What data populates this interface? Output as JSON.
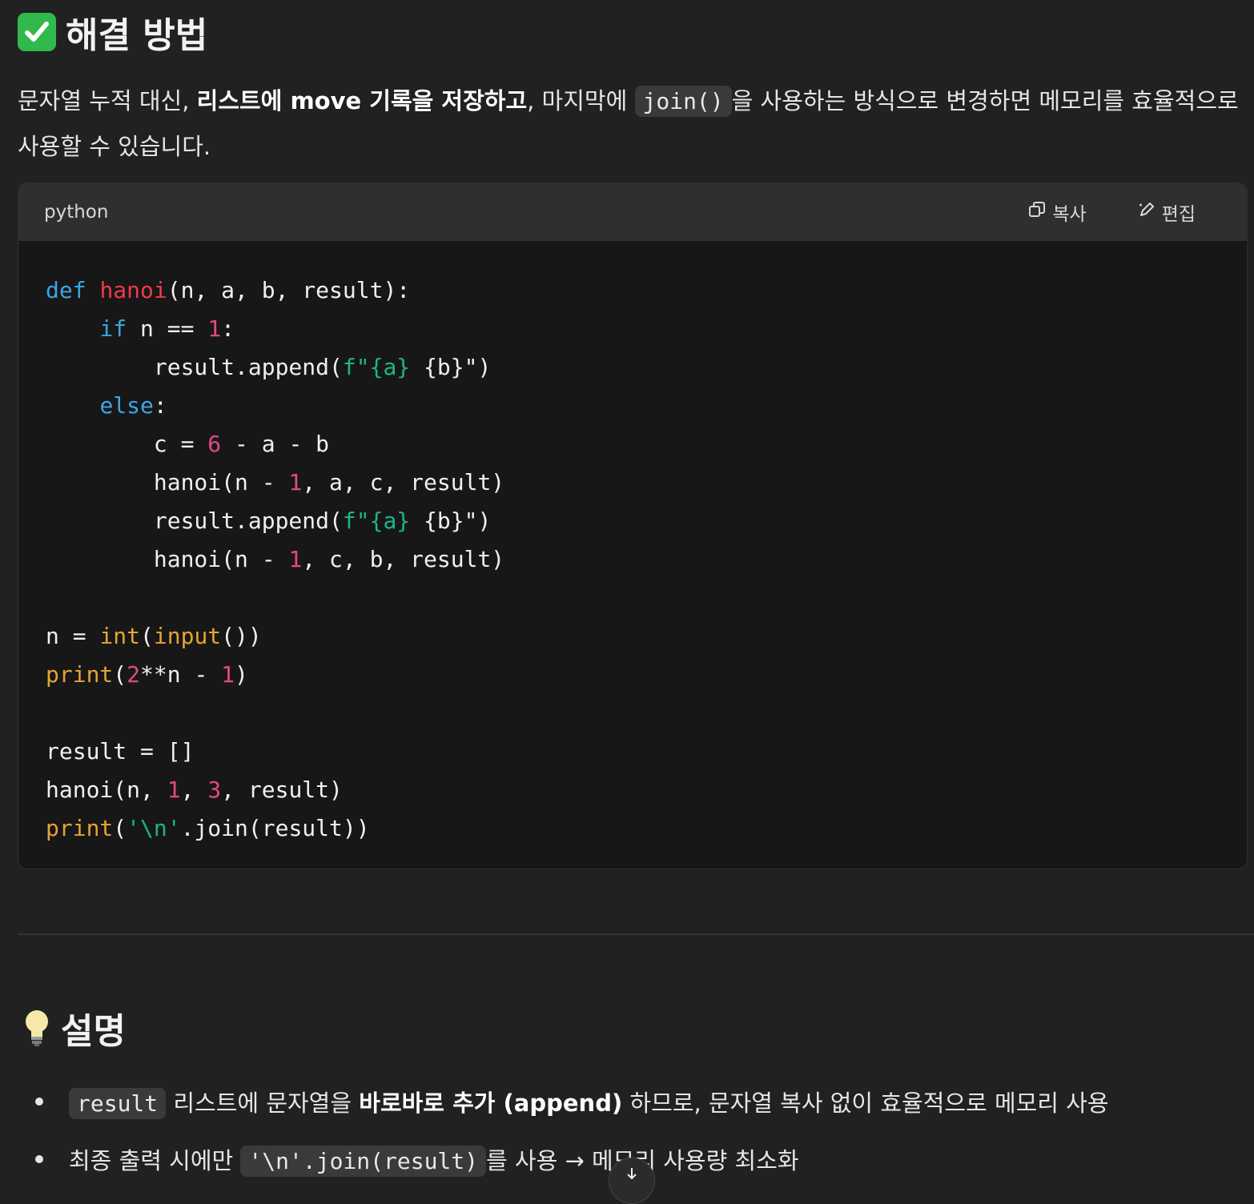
{
  "heading1": {
    "text": "해결 방법",
    "icon": "check-icon"
  },
  "paragraph": {
    "t1": "문자열 누적 대신, ",
    "b1": "리스트에 move 기록을 저장하고",
    "t2": ", 마지막에 ",
    "code1": "join()",
    "t3": "을 사용하는 방식으로 변경하면 메모리를 효율적으로 사용할 수 있습니다."
  },
  "code_block": {
    "language": "python",
    "copy_label": "복사",
    "edit_label": "편집"
  },
  "code": {
    "l1": {
      "kw": "def",
      "fn": "hanoi",
      "rest": "(n, a, b, result):"
    },
    "l2": {
      "kw": "if",
      "mid": " n == ",
      "num": "1",
      "end": ":"
    },
    "l3": {
      "a": "result.append(",
      "s1": "f\"{a}",
      "b": " {b}\")"
    },
    "l4": {
      "kw": "else",
      "end": ":"
    },
    "l5": {
      "a": "c = ",
      "num": "6",
      "b": " - a - b"
    },
    "l6": {
      "a": "hanoi(n - ",
      "num": "1",
      "b": ", a, c, result)"
    },
    "l7": {
      "a": "result.append(",
      "s1": "f\"{a}",
      "b": " {b}\")"
    },
    "l8": {
      "a": "hanoi(n - ",
      "num": "1",
      "b": ", c, b, result)"
    },
    "l9": {
      "a": "n = ",
      "bi1": "int",
      "b": "(",
      "bi2": "input",
      "c": "())"
    },
    "l10": {
      "bi": "print",
      "a": "(",
      "num1": "2",
      "b": "**n - ",
      "num2": "1",
      "c": ")"
    },
    "l11": {
      "a": "result = []"
    },
    "l12": {
      "a": "hanoi(n, ",
      "num1": "1",
      "b": ", ",
      "num2": "3",
      "c": ", result)"
    },
    "l13": {
      "bi": "print",
      "a": "(",
      "str": "'\\n'",
      "b": ".join(result))"
    }
  },
  "heading2": {
    "text": "설명",
    "icon": "lightbulb-icon"
  },
  "bullets": [
    {
      "code": "result",
      "t1": " 리스트에 문자열을 ",
      "b": "바로바로 추가 (append)",
      "t2": " 하므로, 문자열 복사 없이 효율적으로 메모리 사용"
    },
    {
      "t0": "최종 출력 시에만 ",
      "code": "'\\n'.join(result)",
      "t1": "를 사용 → 메모리 사용량 최소화"
    }
  ]
}
